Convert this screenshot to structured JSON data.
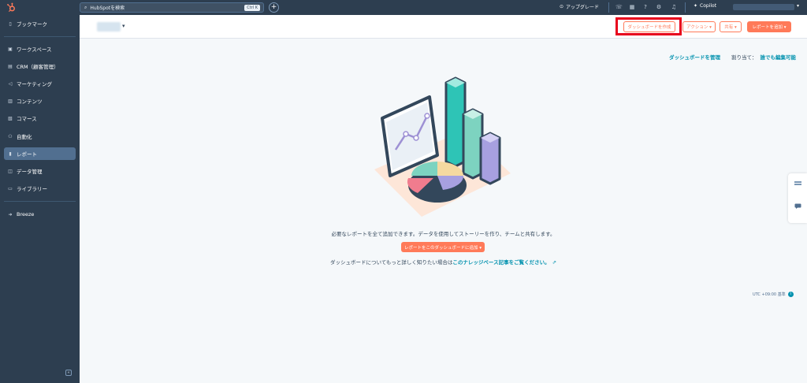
{
  "topbar": {
    "search_placeholder": "HubSpotを検索",
    "search_shortcut": "Ctrl K",
    "upgrade_label": "アップグレード",
    "copilot_label": "Copilot"
  },
  "sidebar": {
    "items": [
      {
        "label": "ブックマーク",
        "icon": "bookmark-icon"
      },
      {
        "label": "ワークスペース",
        "icon": "workspace-icon"
      },
      {
        "label": "CRM（顧客管理）",
        "icon": "crm-icon"
      },
      {
        "label": "マーケティング",
        "icon": "marketing-icon"
      },
      {
        "label": "コンテンツ",
        "icon": "content-icon"
      },
      {
        "label": "コマース",
        "icon": "commerce-icon"
      },
      {
        "label": "自動化",
        "icon": "automation-icon"
      },
      {
        "label": "レポート",
        "icon": "reports-icon"
      },
      {
        "label": "データ管理",
        "icon": "data-icon"
      },
      {
        "label": "ライブラリー",
        "icon": "library-icon"
      },
      {
        "label": "Breeze",
        "icon": "breeze-icon"
      }
    ],
    "active_index": 7
  },
  "header": {
    "create_dashboard_label": "ダッシュボードを作成",
    "actions_label": "アクション ▾",
    "share_label": "共有 ▾",
    "add_report_label": "レポートを追加 ▾"
  },
  "main": {
    "manage_link": "ダッシュボードを管理",
    "assign_label": "割り当て：",
    "assign_value": "誰でも編集可能",
    "empty_desc": "必要なレポートを全て追加できます。データを使用してストーリーを作り、チームと共有します。",
    "add_button": "レポートをこのダッシュボードに追加 ▾",
    "kb_prefix": "ダッシュボードについてもっと詳しく知りたい場合は",
    "kb_link": "このナレッジベース記事をご覧ください。",
    "timezone": "UTC +09:00 基準"
  },
  "colors": {
    "nav_bg": "#2d3e50",
    "accent": "#ff7a59",
    "link": "#0091ae",
    "highlight": "#e8001c"
  }
}
